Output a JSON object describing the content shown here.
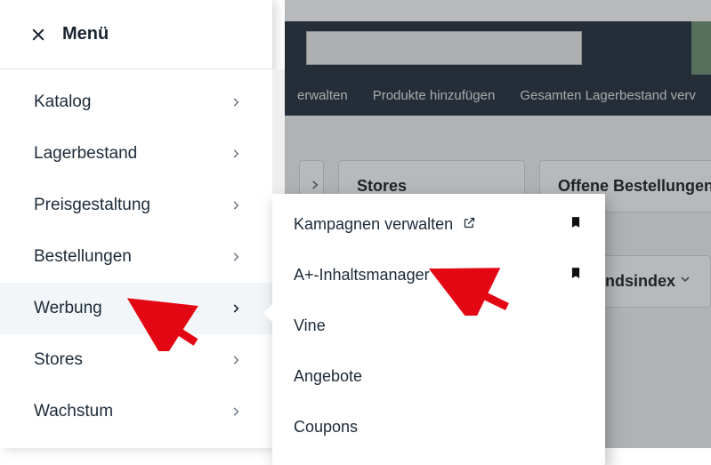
{
  "header": {
    "menu_label": "Menü"
  },
  "sidebar": {
    "items": [
      {
        "label": "Katalog"
      },
      {
        "label": "Lagerbestand"
      },
      {
        "label": "Preisgestaltung"
      },
      {
        "label": "Bestellungen"
      },
      {
        "label": "Werbung"
      },
      {
        "label": "Stores"
      },
      {
        "label": "Wachstum"
      }
    ]
  },
  "submenu": {
    "items": [
      {
        "label": "Kampagnen verwalten",
        "external": true,
        "bookmarked": true
      },
      {
        "label": "A+-Inhaltsmanager",
        "external": false,
        "bookmarked": true
      },
      {
        "label": "Vine"
      },
      {
        "label": "Angebote"
      },
      {
        "label": "Coupons"
      }
    ]
  },
  "secondbar": {
    "items": [
      "erwalten",
      "Produkte hinzufügen",
      "Gesamten Lagerbestand verv"
    ]
  },
  "cards": {
    "row1": [
      {
        "label": "Stores"
      },
      {
        "label": "Offene Bestellungen"
      }
    ],
    "row2": [
      {
        "label": "andsindex"
      }
    ]
  }
}
